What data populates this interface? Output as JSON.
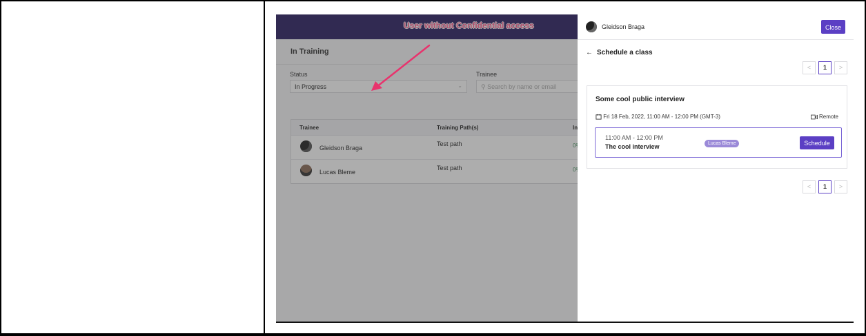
{
  "banner": {
    "text": "User without Confidential access"
  },
  "app": {
    "page_title": "In Training",
    "filters": {
      "status_label": "Status",
      "status_value": "In Progress",
      "trainee_label": "Trainee",
      "search_placeholder": "Search by name or email"
    },
    "table": {
      "headers": [
        "Trainee",
        "Training Path(s)",
        "In"
      ],
      "rows": [
        {
          "trainee": "Gleidson Braga",
          "path": "Test path",
          "progress": "0%"
        },
        {
          "trainee": "Lucas Bleme",
          "path": "Test path",
          "progress": "0%"
        }
      ]
    }
  },
  "panel": {
    "user_name": "Gleidson Braga",
    "close_label": "Close",
    "back_label": "Schedule a class",
    "pagination_top": {
      "prev": "<",
      "page": "1",
      "next": ">"
    },
    "pagination_bottom": {
      "prev": "<",
      "page": "1",
      "next": ">"
    },
    "card": {
      "title": "Some cool public interview",
      "date": "Fri 18 Feb, 2022, 11:00 AM - 12:00 PM (GMT-3)",
      "location": "Remote",
      "slot": {
        "time": "11:00 AM - 12:00 PM",
        "name": "The cool interview",
        "instructor": "Lucas Bleme",
        "schedule_label": "Schedule"
      }
    }
  },
  "colors": {
    "brand": "#5b3fc4",
    "topbar": "#2a1e63",
    "banner_text": "#ff5d92",
    "annotation": "#e8336d"
  }
}
